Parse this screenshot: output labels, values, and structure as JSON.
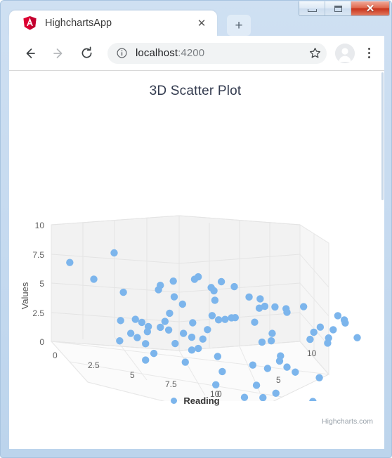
{
  "window": {
    "controls": {
      "minimize_label": "Minimize",
      "maximize_label": "Maximize",
      "close_label": "✕"
    }
  },
  "browser": {
    "tab": {
      "title": "HighchartsApp",
      "favicon": "angular-logo-icon",
      "close_label": "✕"
    },
    "new_tab_label": "+",
    "toolbar": {
      "back_label": "←",
      "forward_label": "→",
      "reload_label": "⟳",
      "site_info_label": "ⓘ",
      "url_host": "localhost",
      "url_port": ":4200",
      "url_full": "localhost:4200",
      "bookmark_label": "☆",
      "profile_label": "profile-avatar-icon",
      "menu_label": "⋮"
    }
  },
  "page": {
    "chart": {
      "title": "3D Scatter Plot",
      "legend_label": "Reading",
      "credits": "Highcharts.com",
      "series_color": "#7cb5ec",
      "title_color": "#333b4f",
      "axis_label_color": "#606060"
    }
  },
  "chart_data": {
    "type": "scatter",
    "title": "3D Scatter Plot",
    "subtitle": "",
    "is_3d": true,
    "xlabel": "",
    "ylabel": "Values",
    "zlabel": "",
    "xlim": [
      0,
      10
    ],
    "ylim": [
      0,
      10
    ],
    "zlim": [
      0,
      10
    ],
    "xticks": [
      0,
      2.5,
      5,
      7.5,
      10
    ],
    "yticks": [
      0,
      2.5,
      5,
      7.5,
      10
    ],
    "zticks": [
      0,
      5,
      10
    ],
    "xticklabels": [
      "0",
      "2.5",
      "5",
      "7.5",
      "10"
    ],
    "yticklabels": [
      "0",
      "2.5",
      "5",
      "7.5",
      "10"
    ],
    "zticklabels": [
      "0",
      "5",
      "10"
    ],
    "grid": true,
    "legend_position": "bottom-center",
    "series": [
      {
        "name": "Reading",
        "color": "#7cb5ec",
        "marker": "circle",
        "points": [
          [
            1.6,
            9.0,
            1.2
          ],
          [
            0.1,
            7.0,
            0.6
          ],
          [
            1.1,
            6.3,
            0.8
          ],
          [
            2.4,
            6.1,
            1.0
          ],
          [
            3.5,
            7.6,
            1.6
          ],
          [
            3.7,
            7.3,
            1.4
          ],
          [
            3.3,
            8.0,
            2.2
          ],
          [
            4.5,
            9.2,
            2.3
          ],
          [
            4.6,
            9.0,
            2.1
          ],
          [
            5.3,
            9.4,
            2.6
          ],
          [
            5.7,
            9.3,
            2.8
          ],
          [
            4.9,
            8.6,
            2.5
          ],
          [
            5.2,
            8.5,
            2.4
          ],
          [
            6.2,
            8.8,
            3.0
          ],
          [
            6.5,
            8.9,
            3.2
          ],
          [
            6.9,
            8.5,
            3.1
          ],
          [
            7.0,
            8.6,
            3.4
          ],
          [
            7.3,
            8.7,
            3.6
          ],
          [
            7.5,
            8.5,
            3.5
          ],
          [
            7.8,
            9.3,
            3.9
          ],
          [
            8.9,
            9.4,
            4.4
          ],
          [
            9.1,
            9.2,
            4.5
          ],
          [
            9.0,
            8.9,
            4.6
          ],
          [
            8.4,
            8.0,
            4.1
          ],
          [
            8.8,
            8.1,
            4.3
          ],
          [
            9.5,
            8.0,
            4.7
          ],
          [
            6.3,
            8.0,
            3.3
          ],
          [
            4.8,
            7.5,
            2.7
          ],
          [
            3.8,
            6.9,
            1.9
          ],
          [
            5.6,
            6.6,
            2.9
          ],
          [
            6.2,
            6.7,
            3.2
          ],
          [
            8.2,
            7.4,
            4.0
          ],
          [
            8.7,
            7.3,
            4.2
          ],
          [
            8.3,
            6.8,
            3.8
          ],
          [
            8.8,
            6.9,
            4.1
          ],
          [
            4.1,
            6.5,
            2.0
          ],
          [
            5.1,
            6.3,
            2.4
          ],
          [
            5.5,
            6.3,
            2.6
          ],
          [
            5.7,
            6.6,
            2.7
          ],
          [
            5.3,
            6.1,
            2.5
          ],
          [
            7.0,
            6.3,
            3.3
          ],
          [
            7.1,
            5.7,
            3.2
          ],
          [
            6.9,
            5.4,
            3.0
          ],
          [
            3.7,
            5.4,
            1.8
          ],
          [
            4.5,
            5.2,
            2.1
          ],
          [
            5.0,
            5.0,
            2.3
          ],
          [
            3.6,
            4.6,
            1.7
          ],
          [
            2.6,
            4.0,
            1.3
          ],
          [
            2.8,
            3.9,
            1.4
          ],
          [
            3.0,
            3.7,
            1.5
          ],
          [
            3.5,
            4.0,
            1.6
          ],
          [
            3.8,
            4.0,
            1.7
          ],
          [
            4.3,
            4.1,
            1.9
          ],
          [
            4.6,
            4.0,
            2.0
          ],
          [
            4.9,
            4.1,
            2.2
          ],
          [
            7.3,
            4.6,
            3.4
          ],
          [
            7.4,
            4.2,
            3.3
          ],
          [
            7.5,
            3.8,
            3.5
          ],
          [
            7.8,
            3.6,
            3.6
          ],
          [
            8.5,
            3.7,
            4.0
          ],
          [
            2.1,
            3.5,
            1.1
          ],
          [
            3.1,
            3.3,
            1.4
          ],
          [
            4.0,
            3.0,
            1.8
          ],
          [
            4.6,
            2.9,
            2.0
          ],
          [
            4.8,
            3.2,
            2.1
          ],
          [
            5.4,
            3.0,
            2.4
          ],
          [
            6.4,
            3.1,
            3.0
          ],
          [
            6.9,
            3.2,
            3.2
          ],
          [
            2.5,
            2.7,
            1.2
          ],
          [
            2.7,
            2.5,
            1.3
          ],
          [
            3.0,
            2.2,
            1.4
          ],
          [
            2.2,
            1.8,
            1.0
          ],
          [
            3.3,
            1.6,
            1.5
          ],
          [
            4.4,
            1.7,
            1.9
          ],
          [
            5.5,
            1.8,
            2.5
          ],
          [
            6.6,
            1.5,
            3.0
          ],
          [
            7.2,
            1.3,
            3.3
          ],
          [
            8.3,
            1.5,
            3.9
          ],
          [
            3.0,
            0.8,
            1.4
          ],
          [
            5.3,
            0.5,
            2.4
          ],
          [
            6.8,
            0.6,
            3.1
          ],
          [
            6.1,
            0.1,
            2.9
          ]
        ]
      }
    ]
  }
}
